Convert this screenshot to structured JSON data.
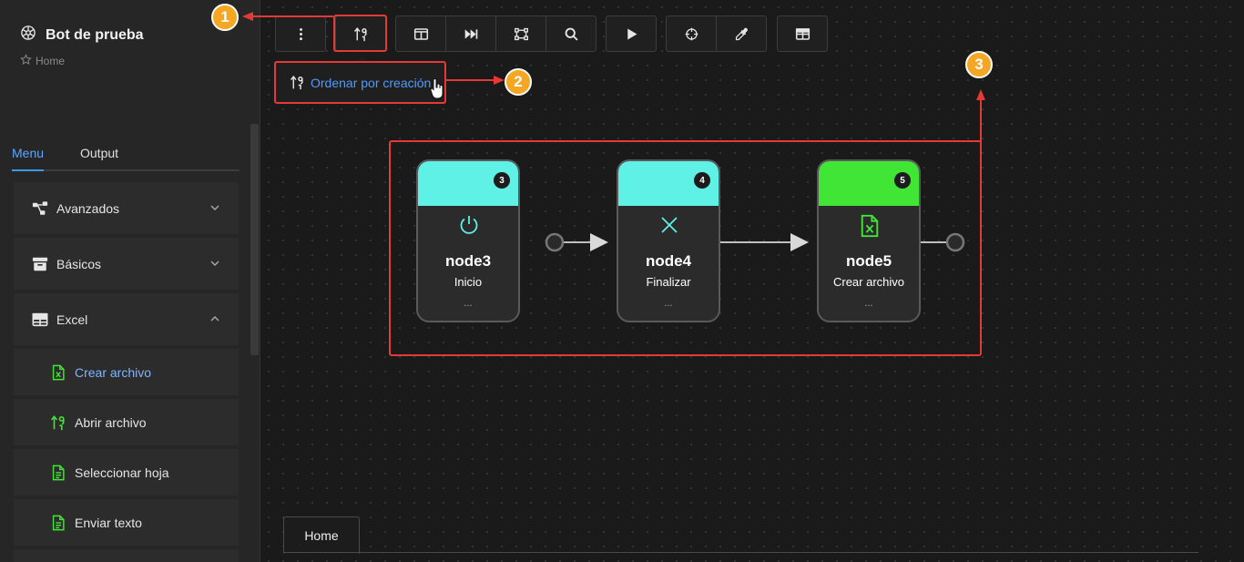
{
  "app": {
    "title": "Bot de prueba",
    "breadcrumb": "Home"
  },
  "sidebar": {
    "tabs": [
      {
        "label": "Menu",
        "active": true
      },
      {
        "label": "Output",
        "active": false
      }
    ],
    "groups": [
      {
        "label": "Avanzados",
        "icon": "branch-icon",
        "expanded": false
      },
      {
        "label": "Básicos",
        "icon": "archive-icon",
        "expanded": false
      },
      {
        "label": "Excel",
        "icon": "table-icon",
        "expanded": true
      }
    ],
    "excel_items": [
      {
        "label": "Crear archivo",
        "icon": "excel-file-icon",
        "active": true
      },
      {
        "label": "Abrir archivo",
        "icon": "sort-icon",
        "active": false
      },
      {
        "label": "Seleccionar hoja",
        "icon": "document-icon",
        "active": false
      },
      {
        "label": "Enviar texto",
        "icon": "document-icon",
        "active": false
      }
    ]
  },
  "toolbar": {
    "buttons": [
      "more-vertical-icon",
      "sort-icon",
      "columns-icon",
      "fast-forward-icon",
      "transform-icon",
      "search-icon",
      "play-icon",
      "crosshair-icon",
      "eyedropper-icon",
      "table-icon"
    ],
    "tooltip": "Ordenar por creación"
  },
  "flow": {
    "nodes": [
      {
        "name": "node3",
        "description": "Inicio",
        "count": "3",
        "more": "...",
        "head_color": "#5ff0e6",
        "icon": "power-icon",
        "icon_color": "#5ff0e6"
      },
      {
        "name": "node4",
        "description": "Finalizar",
        "count": "4",
        "more": "...",
        "head_color": "#5ff0e6",
        "icon": "close-icon",
        "icon_color": "#5ff0e6"
      },
      {
        "name": "node5",
        "description": "Crear archivo",
        "count": "5",
        "more": "...",
        "head_color": "#41e535",
        "icon": "excel-file-icon",
        "icon_color": "#41e535"
      }
    ]
  },
  "annotations": {
    "step1": "1",
    "step2": "2",
    "step3": "3",
    "color": "#e53935"
  },
  "bottom_tabs": [
    {
      "label": "Home"
    }
  ],
  "colors": {
    "accent": "#4096ff",
    "annotation": "#e53935",
    "badge": "#f5a623",
    "excel_green": "#41e535",
    "cyan": "#5ff0e6"
  }
}
